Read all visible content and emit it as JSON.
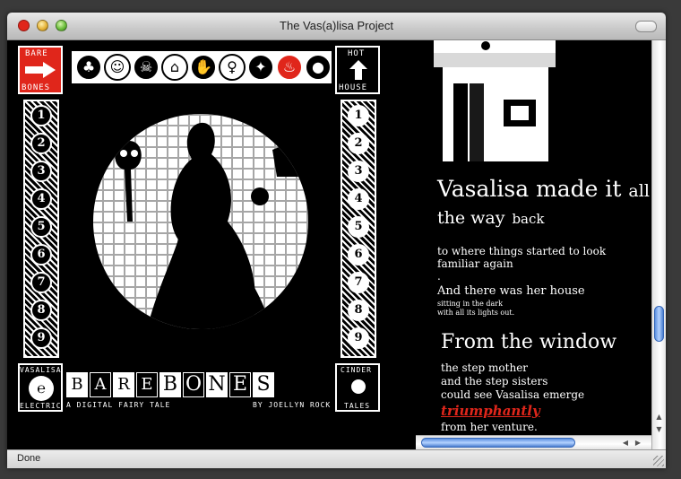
{
  "window": {
    "title": "The Vas(a)lisa Project"
  },
  "status": {
    "text": "Done"
  },
  "nav": {
    "top_left": "BARE",
    "top_left_sub": "BONES",
    "top_right": "HOT",
    "top_right_sub": "HOUSE",
    "bottom_left": "VASALISA",
    "bottom_left_sub": "ELECTRIC",
    "bottom_right": "CINDER",
    "bottom_right_sub": "TALES",
    "left_numbers": [
      "1",
      "2",
      "3",
      "4",
      "5",
      "6",
      "7",
      "8",
      "9"
    ],
    "right_numbers": [
      "1",
      "2",
      "3",
      "4",
      "5",
      "6",
      "7",
      "8",
      "9"
    ],
    "title_letters": [
      "B",
      "A",
      "R",
      "E",
      "B",
      "O",
      "N",
      "E",
      "S"
    ],
    "tagline": "A DIGITAL FAIRY TALE",
    "author": "BY JOELLYN ROCK",
    "icons": [
      "tree-icon",
      "face-icon",
      "skull-icon",
      "house-icon",
      "hand-icon",
      "doll-icon",
      "bird-icon",
      "flame-icon",
      "moon-icon"
    ]
  },
  "story": {
    "line1_big": "Vasalisa made it",
    "line1_small": "all",
    "line2_big": "the way",
    "line2_small": "back",
    "para1": "to where things started to look familiar again",
    "dot": ".",
    "para2": "And there was her house",
    "para3a": "sitting in the dark",
    "para3b": "with all its lights out.",
    "heading_big": "From the window",
    "heading_first": "F",
    "lines": [
      "the step mother",
      "and the step sisters",
      "could see Vasalisa emerge"
    ],
    "emphasis": "triumphantly",
    "ending": "from her venture."
  },
  "colors": {
    "accent": "#e0261b",
    "scroll": "#5a8fe0"
  }
}
